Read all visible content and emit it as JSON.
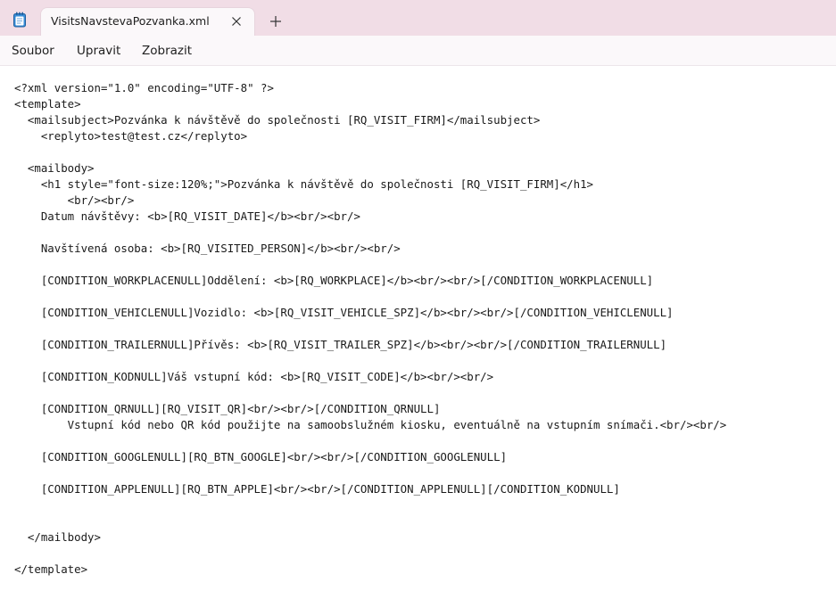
{
  "window": {
    "tab_title": "VisitsNavstevaPozvanka.xml",
    "icons": {
      "app": "notepad-icon",
      "close": "close-icon",
      "new_tab": "plus-icon"
    },
    "colors": {
      "titlebar": "#f1dde6",
      "tab": "#fbf8fa",
      "text": "#1a1a1a"
    }
  },
  "menu": {
    "file": "Soubor",
    "edit": "Upravit",
    "view": "Zobrazit"
  },
  "editor": {
    "lines": [
      "<?xml version=\"1.0\" encoding=\"UTF-8\" ?>",
      "<template>",
      "  <mailsubject>Pozvánka k návštěvě do společnosti [RQ_VISIT_FIRM]</mailsubject>",
      "    <replyto>test@test.cz</replyto>",
      "",
      "  <mailbody>",
      "    <h1 style=\"font-size:120%;\">Pozvánka k návštěvě do společnosti [RQ_VISIT_FIRM]</h1>",
      "        <br/><br/>",
      "    Datum návštěvy: <b>[RQ_VISIT_DATE]</b><br/><br/>",
      "",
      "    Navštívená osoba: <b>[RQ_VISITED_PERSON]</b><br/><br/>",
      "",
      "    [CONDITION_WORKPLACENULL]Oddělení: <b>[RQ_WORKPLACE]</b><br/><br/>[/CONDITION_WORKPLACENULL]",
      "",
      "    [CONDITION_VEHICLENULL]Vozidlo: <b>[RQ_VISIT_VEHICLE_SPZ]</b><br/><br/>[/CONDITION_VEHICLENULL]",
      "",
      "    [CONDITION_TRAILERNULL]Přívěs: <b>[RQ_VISIT_TRAILER_SPZ]</b><br/><br/>[/CONDITION_TRAILERNULL]",
      "",
      "    [CONDITION_KODNULL]Váš vstupní kód: <b>[RQ_VISIT_CODE]</b><br/><br/>",
      "",
      "    [CONDITION_QRNULL][RQ_VISIT_QR]<br/><br/>[/CONDITION_QRNULL]",
      "        Vstupní kód nebo QR kód použijte na samoobslužném kiosku, eventuálně na vstupním snímači.<br/><br/>",
      "",
      "    [CONDITION_GOOGLENULL][RQ_BTN_GOOGLE]<br/><br/>[/CONDITION_GOOGLENULL]",
      "",
      "    [CONDITION_APPLENULL][RQ_BTN_APPLE]<br/><br/>[/CONDITION_APPLENULL][/CONDITION_KODNULL]",
      "",
      "",
      "  </mailbody>",
      "",
      "</template>"
    ]
  }
}
